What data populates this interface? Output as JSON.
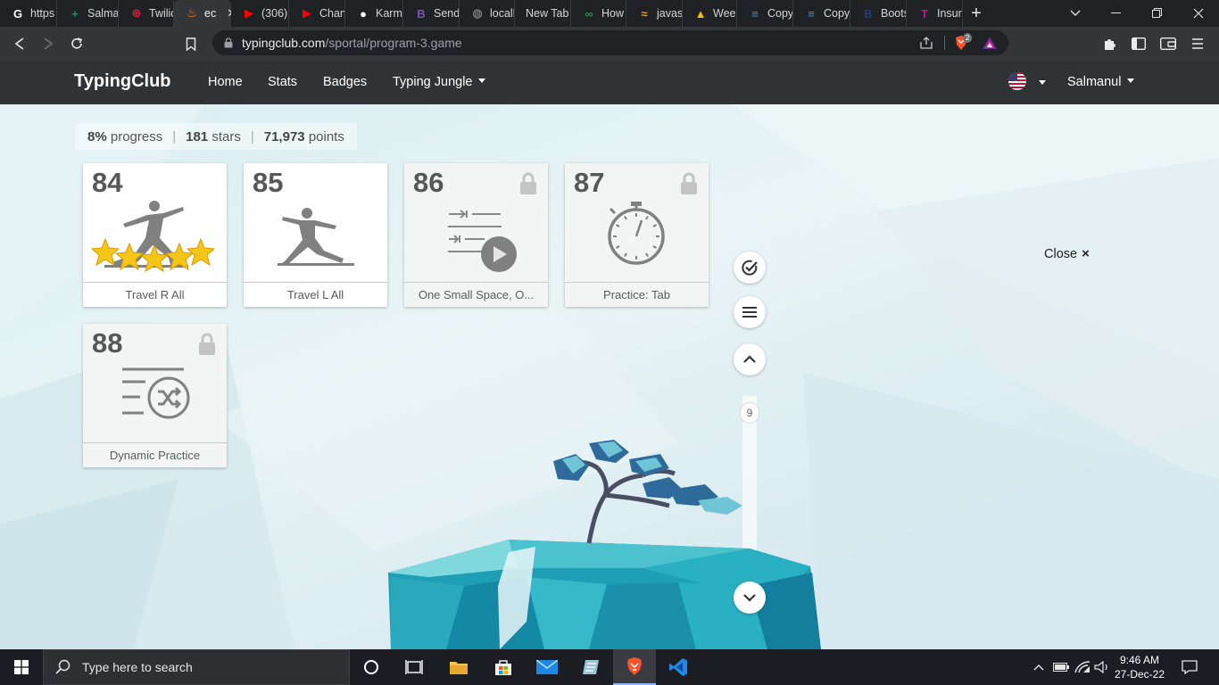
{
  "browser": {
    "tabs": [
      {
        "label": "https",
        "icon": "google-icon",
        "color": "#ffffff",
        "width": 64
      },
      {
        "label": "Salma",
        "icon": "sheets-icon",
        "color": "#0f9d58",
        "width": 69
      },
      {
        "label": "Twilic",
        "icon": "twilio-icon",
        "color": "#e3213d",
        "width": 62
      },
      {
        "label": "ec",
        "icon": "flame-icon",
        "color": "#f08a24",
        "width": 64,
        "active": true
      },
      {
        "label": "(306)",
        "icon": "youtube-icon",
        "color": "#ff0000",
        "width": 65
      },
      {
        "label": "Chan",
        "icon": "youtube-icon",
        "color": "#ff0000",
        "width": 63
      },
      {
        "label": "Karm",
        "icon": "github-icon",
        "color": "#ffffff",
        "width": 65
      },
      {
        "label": "Send",
        "icon": "bootstrap-icon",
        "color": "#7952b3",
        "width": 63
      },
      {
        "label": "localh",
        "icon": "globe-icon",
        "color": "#9aa0a6",
        "width": 62
      },
      {
        "label": "New Tab",
        "icon": "",
        "color": "",
        "width": 63
      },
      {
        "label": "How",
        "icon": "geeks-icon",
        "color": "#2f8d46",
        "width": 62
      },
      {
        "label": "javas",
        "icon": "java-icon",
        "color": "#f89820",
        "width": 63
      },
      {
        "label": "Week",
        "icon": "drive-icon",
        "color": "#fbbc04",
        "width": 61
      },
      {
        "label": "Copy",
        "icon": "docs-icon",
        "color": "#4285f4",
        "width": 63
      },
      {
        "label": "Copy",
        "icon": "docs-icon",
        "color": "#4285f4",
        "width": 64
      },
      {
        "label": "Boots",
        "icon": "bootstrap-icon",
        "color": "#1e3a8a",
        "width": 63
      },
      {
        "label": "Insur",
        "icon": "insur-icon",
        "color": "#c8148c",
        "width": 63
      }
    ],
    "url_host": "typingclub.com",
    "url_path": "/sportal/program-3.game",
    "brave_badge": "2"
  },
  "site": {
    "logo": "TypingClub",
    "nav": [
      "Home",
      "Stats",
      "Badges",
      "Typing Jungle"
    ],
    "user": "Salmanul"
  },
  "stats": {
    "progress_value": "8%",
    "progress_label": "progress",
    "stars_value": "181",
    "stars_label": "stars",
    "points_value": "71,973",
    "points_label": "points"
  },
  "lessons": [
    {
      "number": "84",
      "label": "Travel R All",
      "locked": false,
      "stars": 5
    },
    {
      "number": "85",
      "label": "Travel L All",
      "locked": false,
      "stars": 0
    },
    {
      "number": "86",
      "label": "One Small Space, O...",
      "locked": true
    },
    {
      "number": "87",
      "label": "Practice: Tab",
      "locked": true
    },
    {
      "number": "88",
      "label": "Dynamic Practice",
      "locked": true
    }
  ],
  "controls": {
    "close_label": "Close",
    "close_glyph": "×",
    "page_number": "9"
  },
  "taskbar": {
    "search_placeholder": "Type here to search",
    "time": "9:46 AM",
    "date": "27-Dec-22"
  },
  "colors": {
    "nav_bg": "#2f3335",
    "island_teal": "#2fb7c6",
    "tree_blue": "#3a6ea5",
    "star_yellow": "#f5c518"
  }
}
